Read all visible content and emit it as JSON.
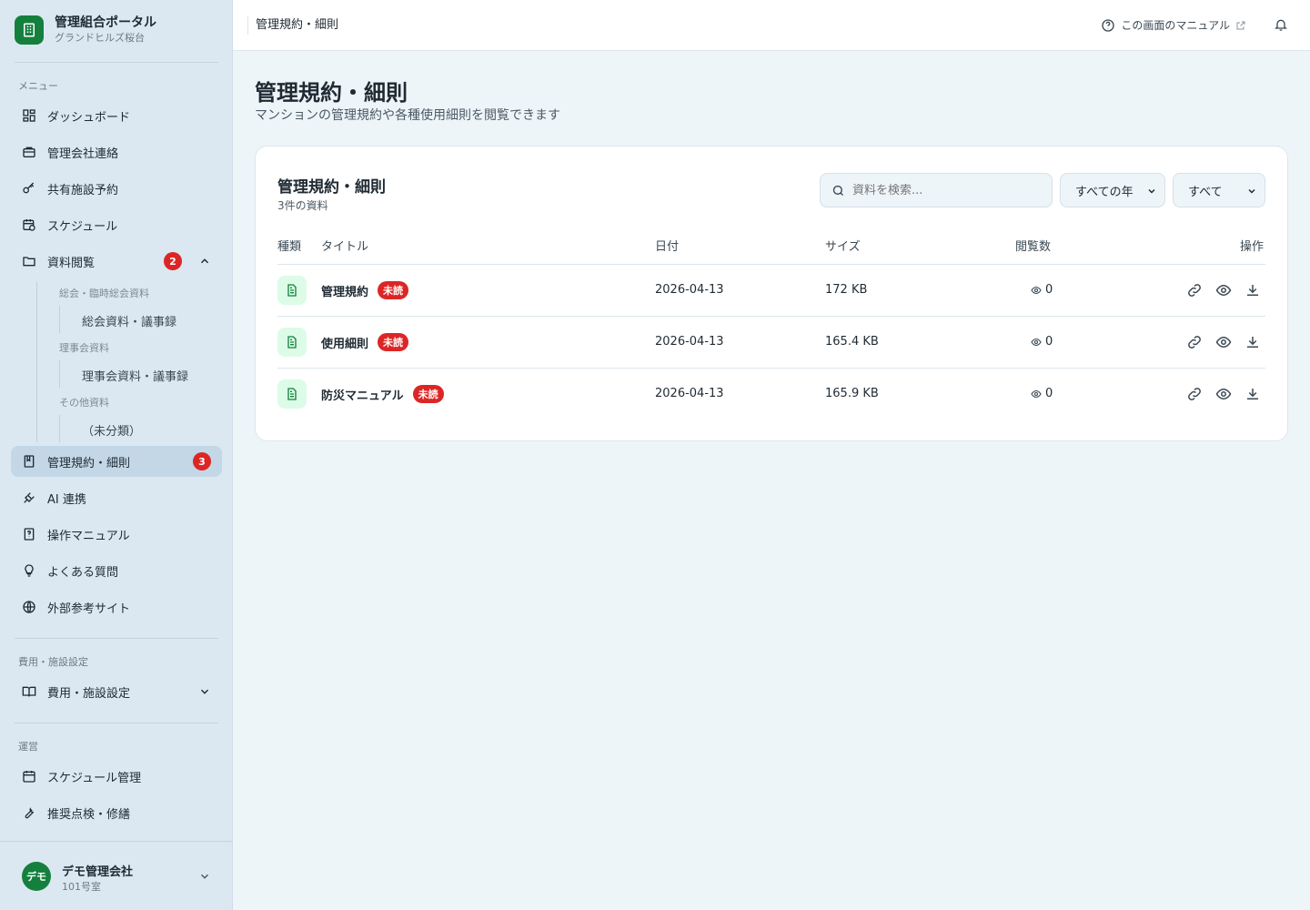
{
  "brand": {
    "title": "管理組合ポータル",
    "subtitle": "グランドヒルズ桜台"
  },
  "sidebar": {
    "menu_label": "メニュー",
    "items": [
      {
        "label": "ダッシュボード",
        "icon": "grid-icon"
      },
      {
        "label": "管理会社連絡",
        "icon": "briefcase-icon"
      },
      {
        "label": "共有施設予約",
        "icon": "key-icon"
      },
      {
        "label": "スケジュール",
        "icon": "calendar-clock-icon"
      },
      {
        "label": "資料閲覧",
        "icon": "folder-icon",
        "badge": "2"
      },
      {
        "label": "管理規約・細則",
        "icon": "book-icon",
        "badge": "3"
      },
      {
        "label": "AI 連携",
        "icon": "plug-icon"
      },
      {
        "label": "操作マニュアル",
        "icon": "help-doc-icon"
      },
      {
        "label": "よくある質問",
        "icon": "lightbulb-icon"
      },
      {
        "label": "外部参考サイト",
        "icon": "globe-icon"
      }
    ],
    "tree": {
      "group1": "総会・臨時総会資料",
      "leaf1": "総会資料・議事録",
      "group2": "理事会資料",
      "leaf2": "理事会資料・議事録",
      "group3": "その他資料",
      "leaf3": "（未分類）"
    },
    "settings_label": "費用・施設設定",
    "settings_item": "費用・施設設定",
    "ops_label": "運営",
    "ops_items": [
      {
        "label": "スケジュール管理"
      },
      {
        "label": "推奨点検・修繕"
      }
    ]
  },
  "user": {
    "avatar": "デモ",
    "name": "デモ管理会社",
    "room": "101号室"
  },
  "topbar": {
    "breadcrumb": "管理規約・細則",
    "manual": "この画面のマニュアル"
  },
  "page": {
    "title": "管理規約・細則",
    "description": "マンションの管理規約や各種使用細則を閲覧できます"
  },
  "card": {
    "title": "管理規約・細則",
    "count": "3件の資料",
    "search_placeholder": "資料を検索...",
    "year_filter": "すべての年",
    "type_filter": "すべて",
    "columns": {
      "type": "種類",
      "title": "タイトル",
      "date": "日付",
      "size": "サイズ",
      "views": "閲覧数",
      "actions": "操作"
    },
    "unread_label": "未読",
    "rows": [
      {
        "title": "管理規約",
        "date": "2026-04-13",
        "size": "172 KB",
        "views": "0"
      },
      {
        "title": "使用細則",
        "date": "2026-04-13",
        "size": "165.4 KB",
        "views": "0"
      },
      {
        "title": "防災マニュアル",
        "date": "2026-04-13",
        "size": "165.9 KB",
        "views": "0"
      }
    ]
  },
  "colors": {
    "brand": "#15803d",
    "badge": "#dc2626",
    "sidebar": "#dbe8f1",
    "active": "#c3d7e6"
  }
}
